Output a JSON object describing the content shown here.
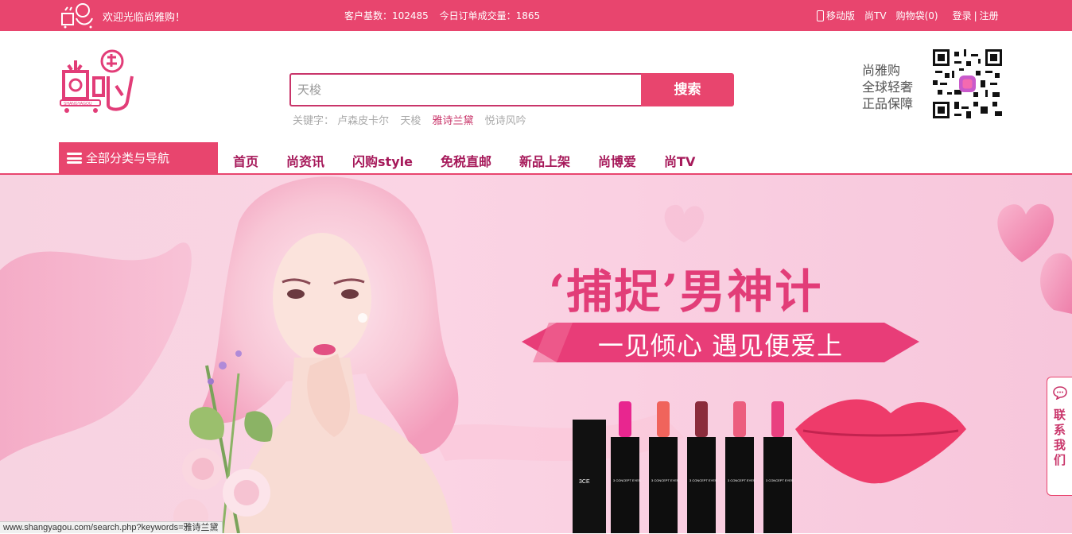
{
  "topbar": {
    "welcome": "欢迎光临尚雅购！",
    "customer_count": "客户基数：102485",
    "orders_today": "今日订单成交量：1865",
    "mobile": "移动版",
    "tv": "尚TV",
    "cart": "购物袋(0)",
    "login": "登录",
    "divider": "|",
    "register": "注册"
  },
  "logo": {
    "text": "尚雅购",
    "subtext": "SHANGYAGOU"
  },
  "search": {
    "placeholder": "天梭",
    "button": "搜索"
  },
  "keywords": {
    "label": "关键字：",
    "items": [
      "卢森皮卡尔",
      "天梭",
      "雅诗兰黛",
      "悦诗风吟"
    ]
  },
  "slogan": [
    "尚雅购",
    "全球轻奢",
    "正品保障"
  ],
  "nav": {
    "all_categories": "全部分类与导航",
    "items": [
      "首页",
      "尚资讯",
      "闪购style",
      "免税直邮",
      "新品上架",
      "尚博爱",
      "尚TV"
    ]
  },
  "banner": {
    "headline": "‘捕捉’男神计",
    "subline": "一见倾心 遇见便爱上",
    "lipstick_brand": "3 CONCEPT EYES",
    "box_logo": "3CE"
  },
  "contact": "联系我们",
  "statusbar": "www.shangyagou.com/search.php?keywords=雅诗兰黛",
  "colors": {
    "brand": "#e8456e",
    "nav_text": "#a6195a"
  }
}
